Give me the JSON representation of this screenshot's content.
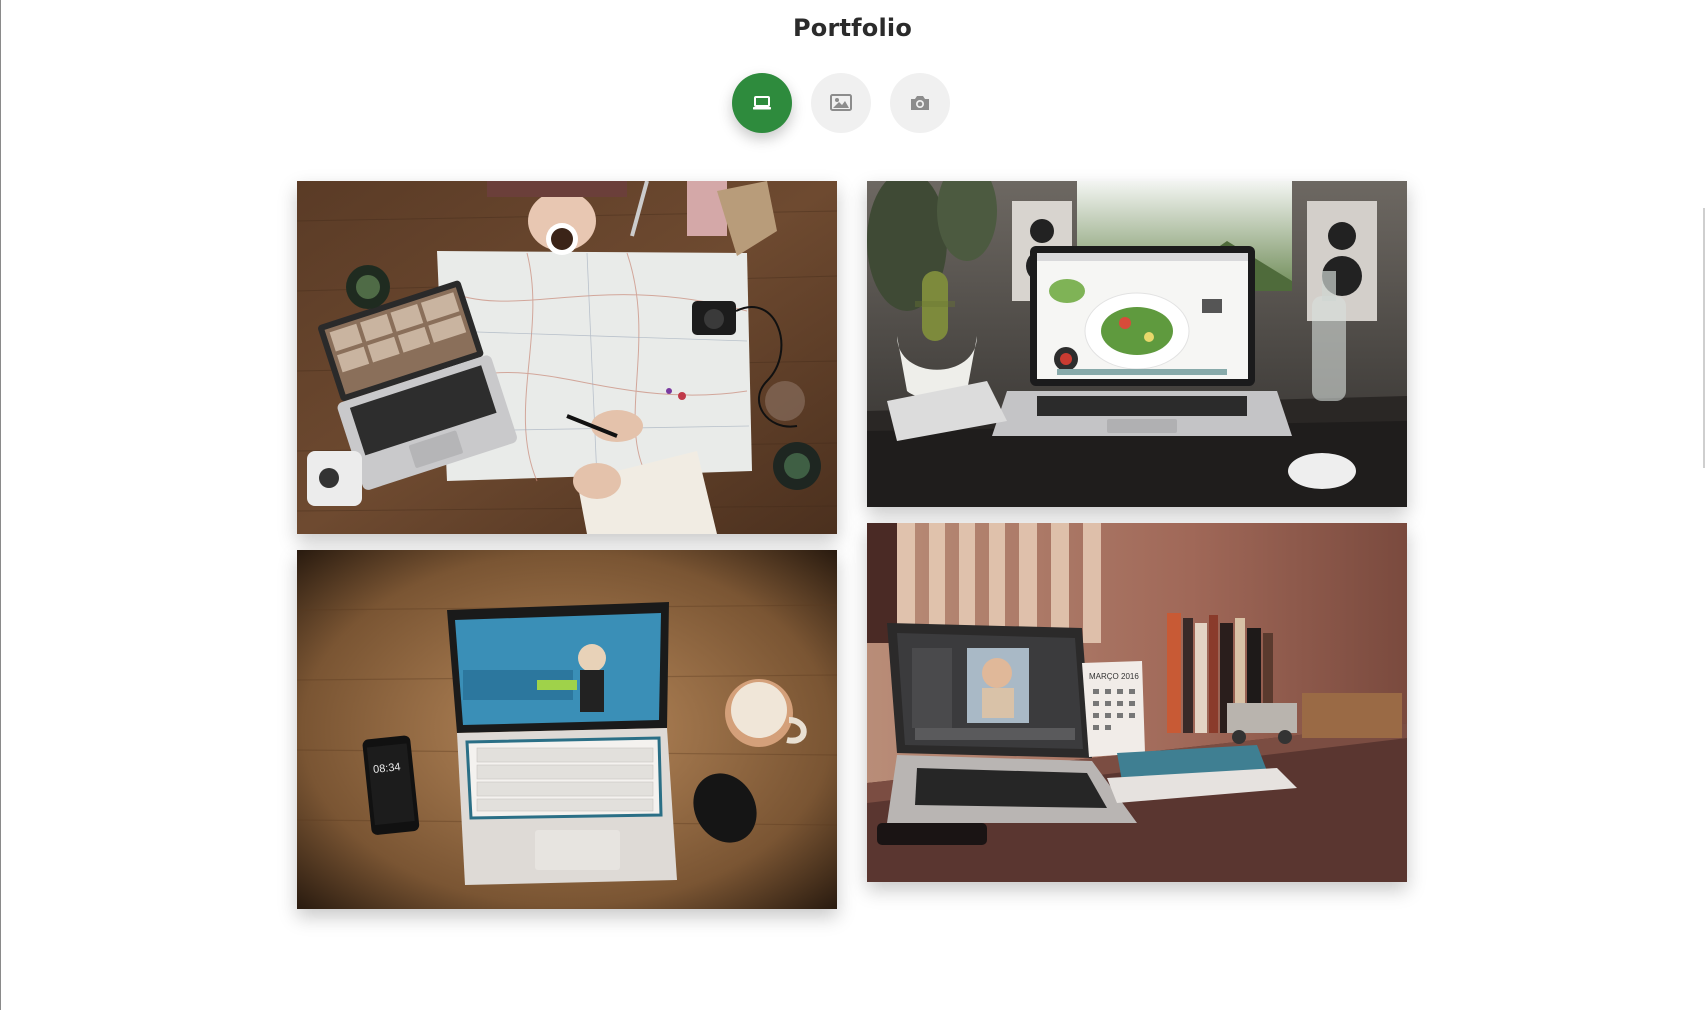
{
  "page": {
    "title": "Portfolio"
  },
  "filters": [
    {
      "icon": "laptop-icon",
      "active": true
    },
    {
      "icon": "image-icon",
      "active": false
    },
    {
      "icon": "camera-icon",
      "active": false
    }
  ],
  "colors": {
    "accent": "#2e8b3d",
    "inactive_button": "#f0f0f0",
    "icon_gray": "#8c8c8c"
  },
  "gallery": {
    "items": [
      {
        "caption": "",
        "time_text": ""
      },
      {
        "caption": "",
        "time_text": ""
      },
      {
        "caption": "",
        "time_text": "08:34"
      },
      {
        "caption": "",
        "calendar_text": "MARÇO 2016"
      }
    ]
  }
}
